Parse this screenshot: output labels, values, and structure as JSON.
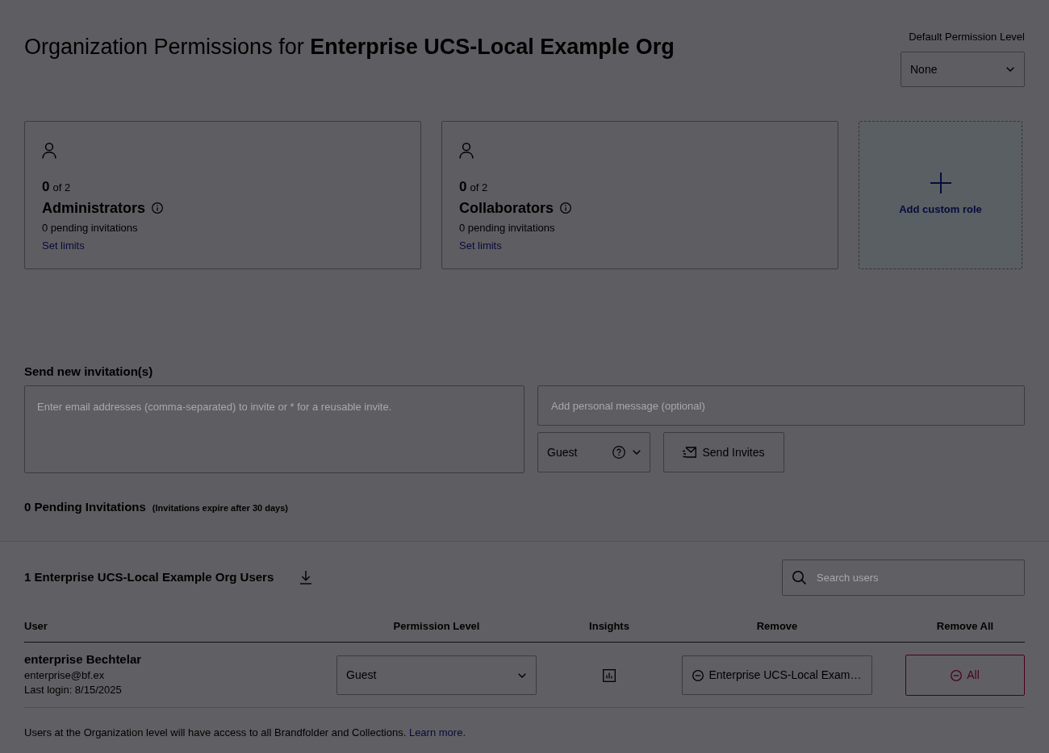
{
  "header": {
    "title": "Organization Permissions for **Enterprise UCS-Local Example Org**",
    "default_permission": {
      "label": "Default Permission Level",
      "value": "None"
    }
  },
  "role_cards": [
    {
      "count": "0",
      "limit": "of 2",
      "name": "Administrators",
      "pending": "0 pending invitations",
      "link": "Set limits"
    },
    {
      "count": "0",
      "limit": "of 2",
      "name": "Collaborators",
      "pending": "0 pending invitations",
      "link": "Set limits"
    }
  ],
  "add_role": {
    "label": "Add custom role"
  },
  "invitations": {
    "heading": "Send new invitation(s)",
    "emails": {
      "placeholder": "Enter email addresses (comma-separated) to invite or * for a reusable invite."
    },
    "message": {
      "placeholder": "Add personal message (optional)"
    },
    "role": {
      "value": "Guest"
    },
    "send_button": "Send Invites",
    "pending": {
      "title": "0 Pending Invitations",
      "note": "(Invitations expire after 30 days)"
    }
  },
  "users": {
    "heading": "1 Enterprise UCS-Local Example Org Users",
    "search": {
      "placeholder": "Search users"
    },
    "columns": [
      "User",
      "Permission Level",
      "Insights",
      "Remove",
      "Remove All"
    ],
    "rows": [
      {
        "name": "enterprise Bechtelar",
        "email": "enterprise@bf.ex",
        "last_login": "Last login: 8/15/2025",
        "permission": "Guest",
        "remove_label": "Enterprise UCS-Local Exam…",
        "remove_all_label": "All"
      }
    ]
  },
  "footer": {
    "text": "Users at the Organization level will have access to all Brandfolder and Collections.",
    "link": "Learn more."
  }
}
